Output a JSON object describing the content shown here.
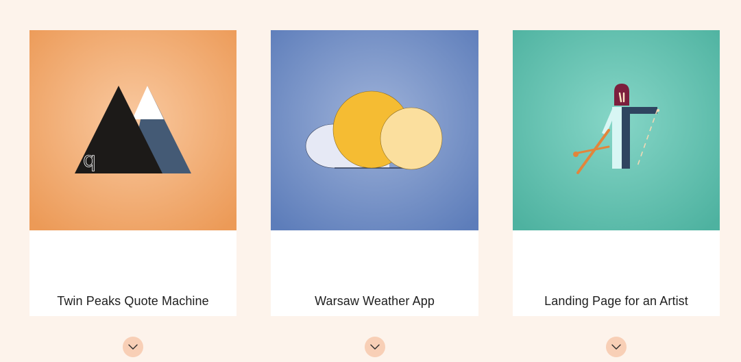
{
  "projects": [
    {
      "title": "Twin Peaks Quote Machine",
      "thumb_icon": "mountains-icon",
      "thumb_color": "#ef9d5b",
      "expand_icon": "chevron-down-icon"
    },
    {
      "title": "Warsaw Weather App",
      "thumb_icon": "sun-cloud-icon",
      "thumb_color": "#5f7fbb",
      "expand_icon": "chevron-down-icon"
    },
    {
      "title": "Landing Page for an Artist",
      "thumb_icon": "artist-figure-icon",
      "thumb_color": "#4fb3a1",
      "expand_icon": "chevron-down-icon"
    }
  ],
  "colors": {
    "page_background": "#fdf3eb",
    "card_background": "#ffffff",
    "expand_button": "#f8cfb6"
  }
}
